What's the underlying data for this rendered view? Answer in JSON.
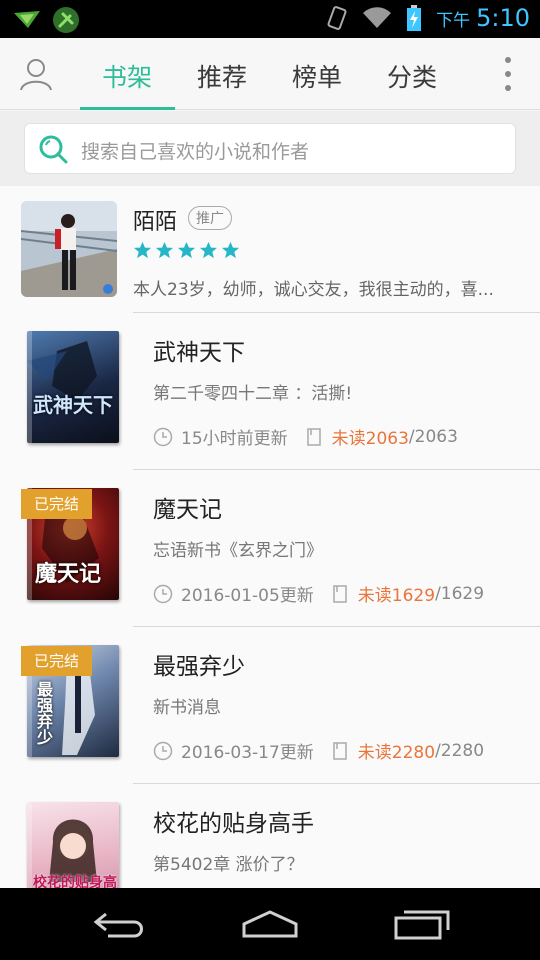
{
  "status_bar": {
    "ampm": "下午",
    "time": "5:10"
  },
  "nav": {
    "tabs": [
      {
        "label": "书架",
        "active": true
      },
      {
        "label": "推荐",
        "active": false
      },
      {
        "label": "榜单",
        "active": false
      },
      {
        "label": "分类",
        "active": false
      }
    ]
  },
  "search": {
    "placeholder": "搜索自己喜欢的小说和作者"
  },
  "promo": {
    "name": "陌陌",
    "tag": "推广",
    "rating": 5,
    "description": "本人23岁，幼师，诚心交友，我很主动的，喜..."
  },
  "books": [
    {
      "title": "武神天下",
      "latest": "第二千零四十二章 ：活撕!",
      "updated": "15小时前更新",
      "unread_label": "未读2063",
      "total": "/2063",
      "completed": false,
      "cover_text": "武神天下",
      "cover_color": "#1e2f4a"
    },
    {
      "title": "魔天记",
      "latest": "忘语新书《玄界之门》",
      "updated": "2016-01-05更新",
      "unread_label": "未读1629",
      "total": "/1629",
      "completed": true,
      "badge": "已完结",
      "cover_text": "魔天记",
      "cover_color": "#5a0f12"
    },
    {
      "title": "最强弃少",
      "latest": "新书消息",
      "updated": "2016-03-17更新",
      "unread_label": "未读2280",
      "total": "/2280",
      "completed": true,
      "badge": "已完结",
      "cover_text": "最强弃少",
      "cover_color": "#2c3f5c"
    },
    {
      "title": "校花的贴身高手",
      "latest": "第5402章 涨价了？",
      "updated": "",
      "unread_label": "",
      "total": "",
      "completed": false,
      "cover_text": "校花的贴身高手",
      "cover_color": "#e7b5c4"
    }
  ],
  "colors": {
    "accent": "#2ebd9a",
    "unread": "#e9753a",
    "badge": "#e2a12d",
    "star": "#25b7c7"
  }
}
